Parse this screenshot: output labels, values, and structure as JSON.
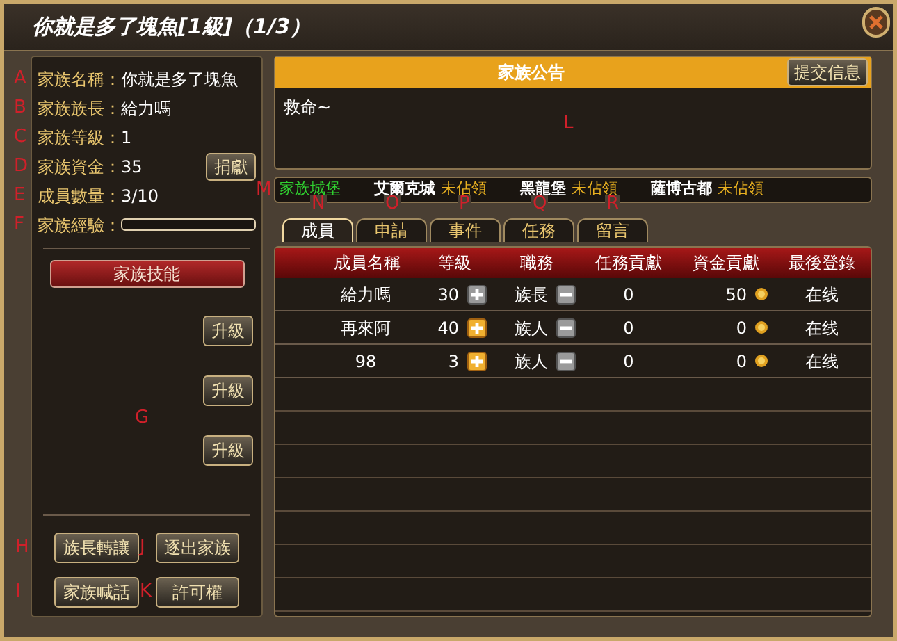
{
  "window": {
    "title": "你就是多了塊魚[1級]（1/3）"
  },
  "info": [
    {
      "marker": "A",
      "label": "家族名稱：",
      "value": "你就是多了塊魚"
    },
    {
      "marker": "B",
      "label": "家族族長：",
      "value": "給力嗎"
    },
    {
      "marker": "C",
      "label": "家族等級：",
      "value": "1"
    },
    {
      "marker": "D",
      "label": "家族資金：",
      "value": "35",
      "button": "捐獻"
    },
    {
      "marker": "E",
      "label": "成員數量：",
      "value": "3/10"
    },
    {
      "marker": "F",
      "label": "家族經驗：",
      "level": 0.0
    }
  ],
  "skills": {
    "title": "家族技能",
    "marker": "G",
    "buttons": [
      "升級",
      "升級",
      "升級"
    ]
  },
  "actions": [
    {
      "marker": "H",
      "label": "族長轉讓"
    },
    {
      "marker": "J",
      "label": "逐出家族"
    },
    {
      "marker": "I",
      "label": "家族喊話"
    },
    {
      "marker": "K",
      "label": "許可權"
    }
  ],
  "notice": {
    "title": "家族公告",
    "button": "提交信息",
    "text": "救命~",
    "marker": "L"
  },
  "castles": {
    "marker": "M",
    "title": "家族城堡",
    "items": [
      {
        "name": "艾爾克城",
        "status": "未佔領"
      },
      {
        "name": "黑龍堡",
        "status": "未佔領"
      },
      {
        "name": "薩博古都",
        "status": "未佔領"
      }
    ]
  },
  "tabs": [
    {
      "marker": "N",
      "label": "成員",
      "selected": true
    },
    {
      "marker": "O",
      "label": "申請",
      "selected": false
    },
    {
      "marker": "P",
      "label": "事件",
      "selected": false
    },
    {
      "marker": "Q",
      "label": "任務",
      "selected": false
    },
    {
      "marker": "R",
      "label": "留言",
      "selected": false
    }
  ],
  "table": {
    "columns": [
      "成員名稱",
      "等級",
      "職務",
      "任務貢獻",
      "資金貢獻",
      "最後登錄"
    ],
    "rows": [
      {
        "name": "給力嗎",
        "level": "30",
        "promote_enabled": false,
        "role": "族長",
        "task": "0",
        "funds": "50",
        "last": "在线"
      },
      {
        "name": "再來阿",
        "level": "40",
        "promote_enabled": true,
        "role": "族人",
        "task": "0",
        "funds": "0",
        "last": "在线"
      },
      {
        "name": "98",
        "level": "3",
        "promote_enabled": true,
        "role": "族人",
        "task": "0",
        "funds": "0",
        "last": "在线"
      }
    ]
  }
}
